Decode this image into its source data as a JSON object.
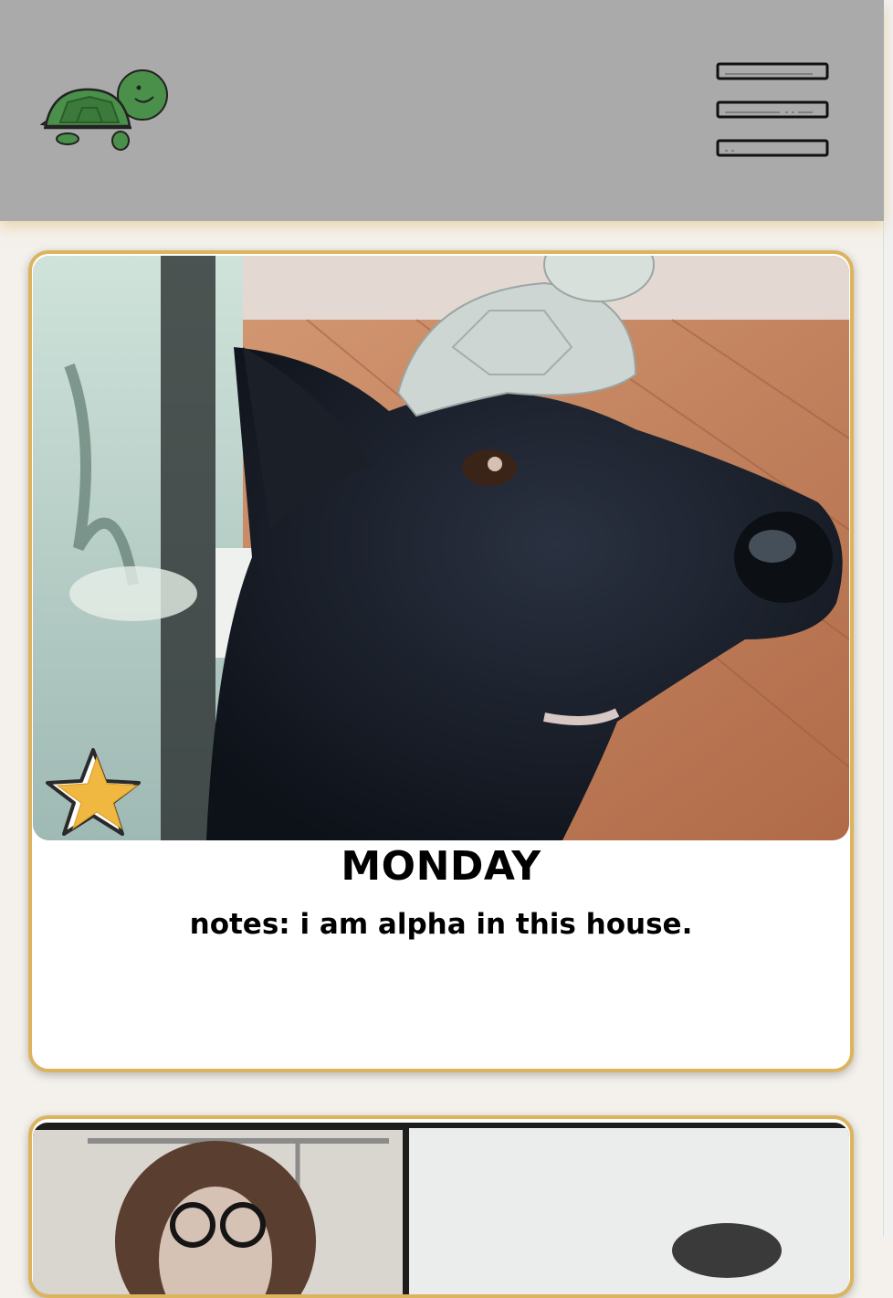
{
  "header": {
    "logo_icon": "turtle-icon",
    "menu_icon": "hamburger-menu-icon",
    "background": "#aaaaaa"
  },
  "cards": [
    {
      "day": "MONDAY",
      "notes": "notes: i am alpha in this house.",
      "favorite_icon": "star-icon",
      "photo_icon": "dog-photo"
    },
    {
      "photo_icon": "video-call-photo"
    }
  ],
  "colors": {
    "accent_border": "#dcb45e",
    "star_fill": "#f0b840"
  }
}
